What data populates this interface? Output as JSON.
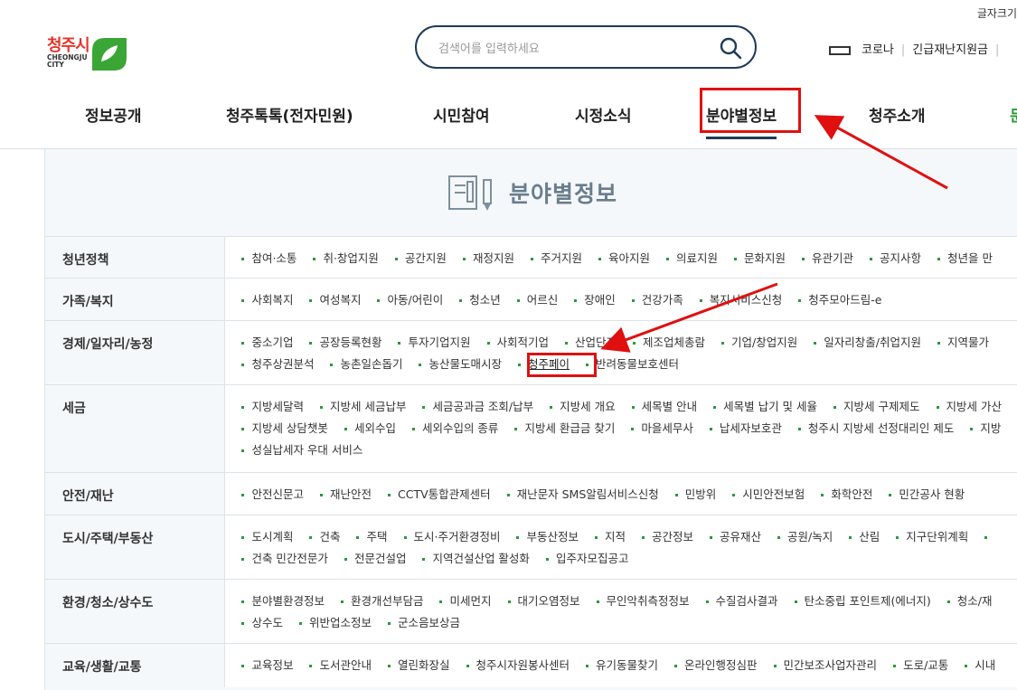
{
  "header": {
    "font_size_label": "글자크기",
    "logo_korean": "청주시",
    "logo_english_1": "CHEONGJU",
    "logo_english_2": "CITY",
    "search_placeholder": "검색어를 입력하세요",
    "top_links": [
      "코로나",
      "긴급재난지원금"
    ]
  },
  "gnb": {
    "items": [
      "정보공개",
      "청주톡톡(전자민원)",
      "시민참여",
      "시정소식",
      "분야별정보",
      "청주소개",
      "문"
    ],
    "active": "분야별정보"
  },
  "panel": {
    "title": "분야별정보"
  },
  "categories": [
    {
      "name": "청년정책",
      "links": [
        [
          "참여·소통",
          "취·창업지원",
          "공간지원",
          "재정지원",
          "주거지원",
          "육아지원",
          "의료지원",
          "문화지원",
          "유관기관",
          "공지사항",
          "청년을 만"
        ]
      ]
    },
    {
      "name": "가족/복지",
      "links": [
        [
          "사회복지",
          "여성복지",
          "아동/어린이",
          "청소년",
          "어르신",
          "장애인",
          "건강가족",
          "복지서비스신청",
          "청주모아드림-e"
        ]
      ]
    },
    {
      "name": "경제/일자리/농정",
      "links": [
        [
          "중소기업",
          "공장등록현황",
          "투자기업지원",
          "사회적기업",
          "산업단지",
          "제조업체총람",
          "기업/창업지원",
          "일자리창출/취업지원",
          "지역물가"
        ],
        [
          "청주상권분석",
          "농촌일손돕기",
          "농산물도매시장",
          "청주페이",
          "반려동물보호센터"
        ]
      ]
    },
    {
      "name": "세금",
      "links": [
        [
          "지방세달력",
          "지방세 세금납부",
          "세금공과금 조회/납부",
          "지방세 개요",
          "세목별 안내",
          "세목별 납기 및 세율",
          "지방세 구제제도",
          "지방세 가산"
        ],
        [
          "지방세 상담챗봇",
          "세외수입",
          "세외수입의 종류",
          "지방세 환급금 찾기",
          "마을세무사",
          "납세자보호관",
          "청주시 지방세 선정대리인 제도",
          "지방"
        ],
        [
          "성실납세자 우대 서비스"
        ]
      ]
    },
    {
      "name": "안전/재난",
      "links": [
        [
          "안전신문고",
          "재난안전",
          "CCTV통합관제센터",
          "재난문자 SMS알림서비스신청",
          "민방위",
          "시민안전보험",
          "화학안전",
          "민간공사 현황"
        ]
      ]
    },
    {
      "name": "도시/주택/부동산",
      "links": [
        [
          "도시계획",
          "건축",
          "주택",
          "도시·주거환경정비",
          "부동산정보",
          "지적",
          "공간정보",
          "공유재산",
          "공원/녹지",
          "산림",
          "지구단위계획",
          ""
        ],
        [
          "건축 민간전문가",
          "전문건설업",
          "지역건설산업 활성화",
          "입주자모집공고"
        ]
      ]
    },
    {
      "name": "환경/청소/상수도",
      "links": [
        [
          "분야별환경정보",
          "환경개선부담금",
          "미세먼지",
          "대기오염정보",
          "무인악취측정정보",
          "수질검사결과",
          "탄소중립 포인트제(에너지)",
          "청소/재"
        ],
        [
          "상수도",
          "위반업소정보",
          "군소음보상금"
        ]
      ]
    },
    {
      "name": "교육/생활/교통",
      "links": [
        [
          "교육정보",
          "도서관안내",
          "열린화장실",
          "청주시자원봉사센터",
          "유기동물찾기",
          "온라인행정심판",
          "민간보조사업자관리",
          "도로/교통",
          "시내"
        ]
      ]
    }
  ],
  "highlight_link": "청주페이",
  "colors": {
    "nav_active": "#1f3c57",
    "annotation_red": "#e01010",
    "bullet_green": "#2a9a38",
    "logo_green": "#3aa635",
    "logo_red": "#e8332a"
  }
}
